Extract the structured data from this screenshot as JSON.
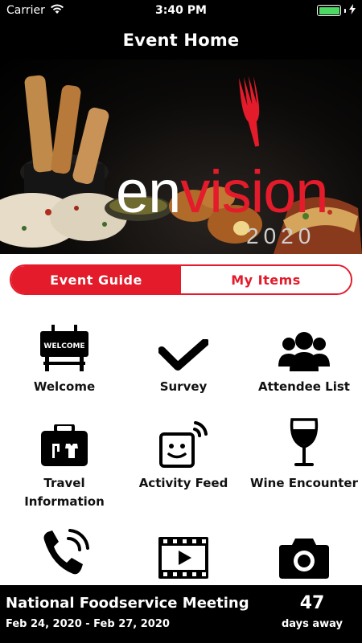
{
  "status_bar": {
    "carrier": "Carrier",
    "time": "3:40 PM"
  },
  "nav": {
    "title": "Event Home"
  },
  "hero": {
    "brand_prefix": "en",
    "brand_suffix": "vision",
    "brand_year": "2020"
  },
  "tabs": [
    {
      "label": "Event Guide",
      "selected": true
    },
    {
      "label": "My Items",
      "selected": false
    }
  ],
  "tiles": [
    {
      "label": "Welcome",
      "icon": "welcome-sign-icon"
    },
    {
      "label": "Survey",
      "icon": "checkmark-icon"
    },
    {
      "label": "Attendee List",
      "icon": "people-icon"
    },
    {
      "label": "Travel Information",
      "icon": "luggage-icon"
    },
    {
      "label": "Activity Feed",
      "icon": "activity-feed-icon"
    },
    {
      "label": "Wine Encounter",
      "icon": "wine-glass-icon"
    },
    {
      "label": "",
      "icon": "phone-icon"
    },
    {
      "label": "",
      "icon": "video-icon"
    },
    {
      "label": "",
      "icon": "camera-icon"
    }
  ],
  "footer": {
    "event_name": "National Foodservice Meeting",
    "dates": "Feb 24, 2020 - Feb 27, 2020",
    "days_count": "47",
    "days_label": "days away"
  },
  "colors": {
    "accent": "#e31b2a",
    "battery": "#4cd964",
    "background": "#000000"
  }
}
